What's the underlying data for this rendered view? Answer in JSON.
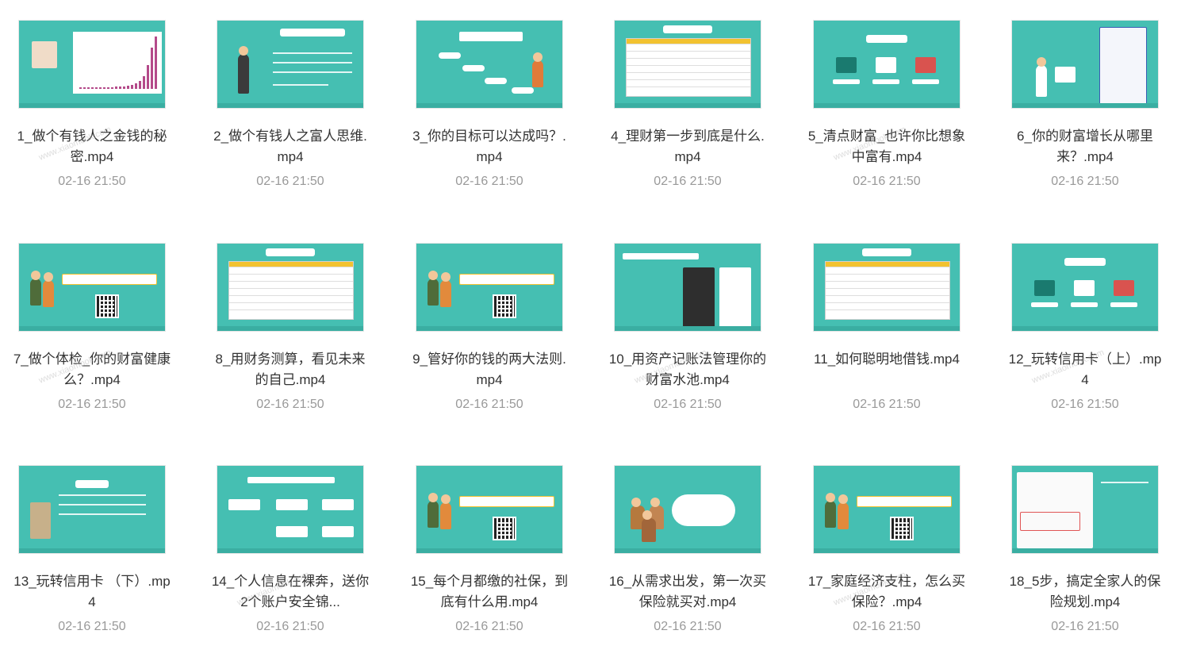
{
  "watermark": "www.xiaomook.com",
  "date": "02-16 21:50",
  "videos": [
    {
      "caption": "1_做个有钱人之金钱的秘密.mp4",
      "date": "02-16 21:50",
      "thumb": "chart"
    },
    {
      "caption": "2_做个有钱人之富人思维.mp4",
      "date": "02-16 21:50",
      "thumb": "person"
    },
    {
      "caption": "3_你的目标可以达成吗？.mp4",
      "date": "02-16 21:50",
      "thumb": "dialog"
    },
    {
      "caption": "4_理财第一步到底是什么.mp4",
      "date": "02-16 21:50",
      "thumb": "table"
    },
    {
      "caption": "5_清点财富_也许你比想象中富有.mp4",
      "date": "02-16 21:50",
      "thumb": "icons"
    },
    {
      "caption": "6_你的财富增长从哪里来？.mp4",
      "date": "02-16 21:50",
      "thumb": "sheet"
    },
    {
      "caption": "7_做个体检_你的财富健康么？.mp4",
      "date": "02-16 21:50",
      "thumb": "qr"
    },
    {
      "caption": "8_用财务测算，看见未来的自己.mp4",
      "date": "02-16 21:50",
      "thumb": "table"
    },
    {
      "caption": "9_管好你的钱的两大法则.mp4",
      "date": "02-16 21:50",
      "thumb": "qr"
    },
    {
      "caption": "10_用资产记账法管理你的财富水池.mp4",
      "date": "02-16 21:50",
      "thumb": "phone"
    },
    {
      "caption": "11_如何聪明地借钱.mp4",
      "date": "02-16 21:50",
      "thumb": "table"
    },
    {
      "caption": "12_玩转信用卡（上）.mp4",
      "date": "02-16 21:50",
      "thumb": "icons"
    },
    {
      "caption": "13_玩转信用卡 （下）.mp4",
      "date": "02-16 21:50",
      "thumb": "robot"
    },
    {
      "caption": "14_个人信息在裸奔，送你2个账户安全锦...",
      "date": "02-16 21:50",
      "thumb": "flow"
    },
    {
      "caption": "15_每个月都缴的社保，到底有什么用.mp4",
      "date": "02-16 21:50",
      "thumb": "qr"
    },
    {
      "caption": "16_从需求出发，第一次买保险就买对.mp4",
      "date": "02-16 21:50",
      "thumb": "family"
    },
    {
      "caption": "17_家庭经济支柱，怎么买保险？.mp4",
      "date": "02-16 21:50",
      "thumb": "qr"
    },
    {
      "caption": "18_5步，搞定全家人的保险规划.mp4",
      "date": "02-16 21:50",
      "thumb": "form"
    }
  ]
}
